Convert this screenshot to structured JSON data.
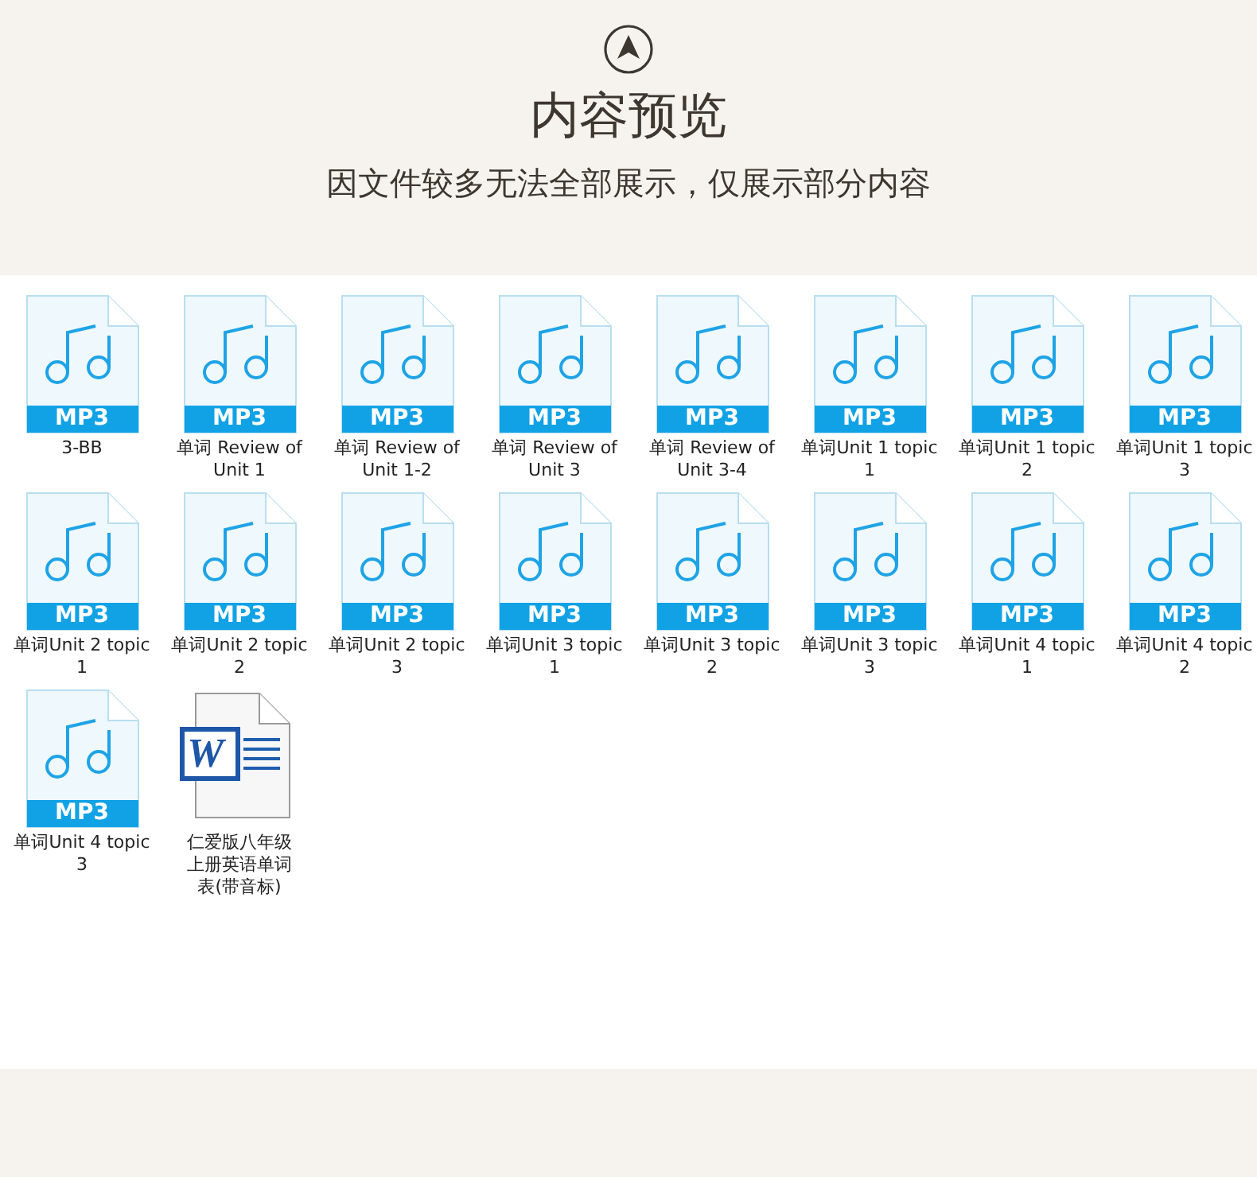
{
  "header": {
    "title": "内容预览",
    "subtitle": "因文件较多无法全部展示，仅展示部分内容"
  },
  "files": [
    {
      "kind": "mp3",
      "badge": "MP3",
      "name": "3-BB"
    },
    {
      "kind": "mp3",
      "badge": "MP3",
      "name": "单词 Review of Unit 1"
    },
    {
      "kind": "mp3",
      "badge": "MP3",
      "name": "单词 Review of Unit 1-2"
    },
    {
      "kind": "mp3",
      "badge": "MP3",
      "name": "单词 Review of Unit 3"
    },
    {
      "kind": "mp3",
      "badge": "MP3",
      "name": "单词 Review of Unit 3-4"
    },
    {
      "kind": "mp3",
      "badge": "MP3",
      "name": "单词Unit 1 topic 1"
    },
    {
      "kind": "mp3",
      "badge": "MP3",
      "name": "单词Unit 1 topic 2"
    },
    {
      "kind": "mp3",
      "badge": "MP3",
      "name": "单词Unit 1 topic 3"
    },
    {
      "kind": "mp3",
      "badge": "MP3",
      "name": "单词Unit 2 topic 1"
    },
    {
      "kind": "mp3",
      "badge": "MP3",
      "name": "单词Unit 2 topic 2"
    },
    {
      "kind": "mp3",
      "badge": "MP3",
      "name": "单词Unit 2 topic 3"
    },
    {
      "kind": "mp3",
      "badge": "MP3",
      "name": "单词Unit 3 topic 1"
    },
    {
      "kind": "mp3",
      "badge": "MP3",
      "name": "单词Unit 3 topic 2"
    },
    {
      "kind": "mp3",
      "badge": "MP3",
      "name": "单词Unit 3 topic 3"
    },
    {
      "kind": "mp3",
      "badge": "MP3",
      "name": "单词Unit 4 topic 1"
    },
    {
      "kind": "mp3",
      "badge": "MP3",
      "name": "单词Unit 4 topic 2"
    },
    {
      "kind": "mp3",
      "badge": "MP3",
      "name": "单词Unit 4 topic 3"
    },
    {
      "kind": "word",
      "badge": "W",
      "name": "仁爱版八年级上册英语单词表(带音标)"
    }
  ]
}
